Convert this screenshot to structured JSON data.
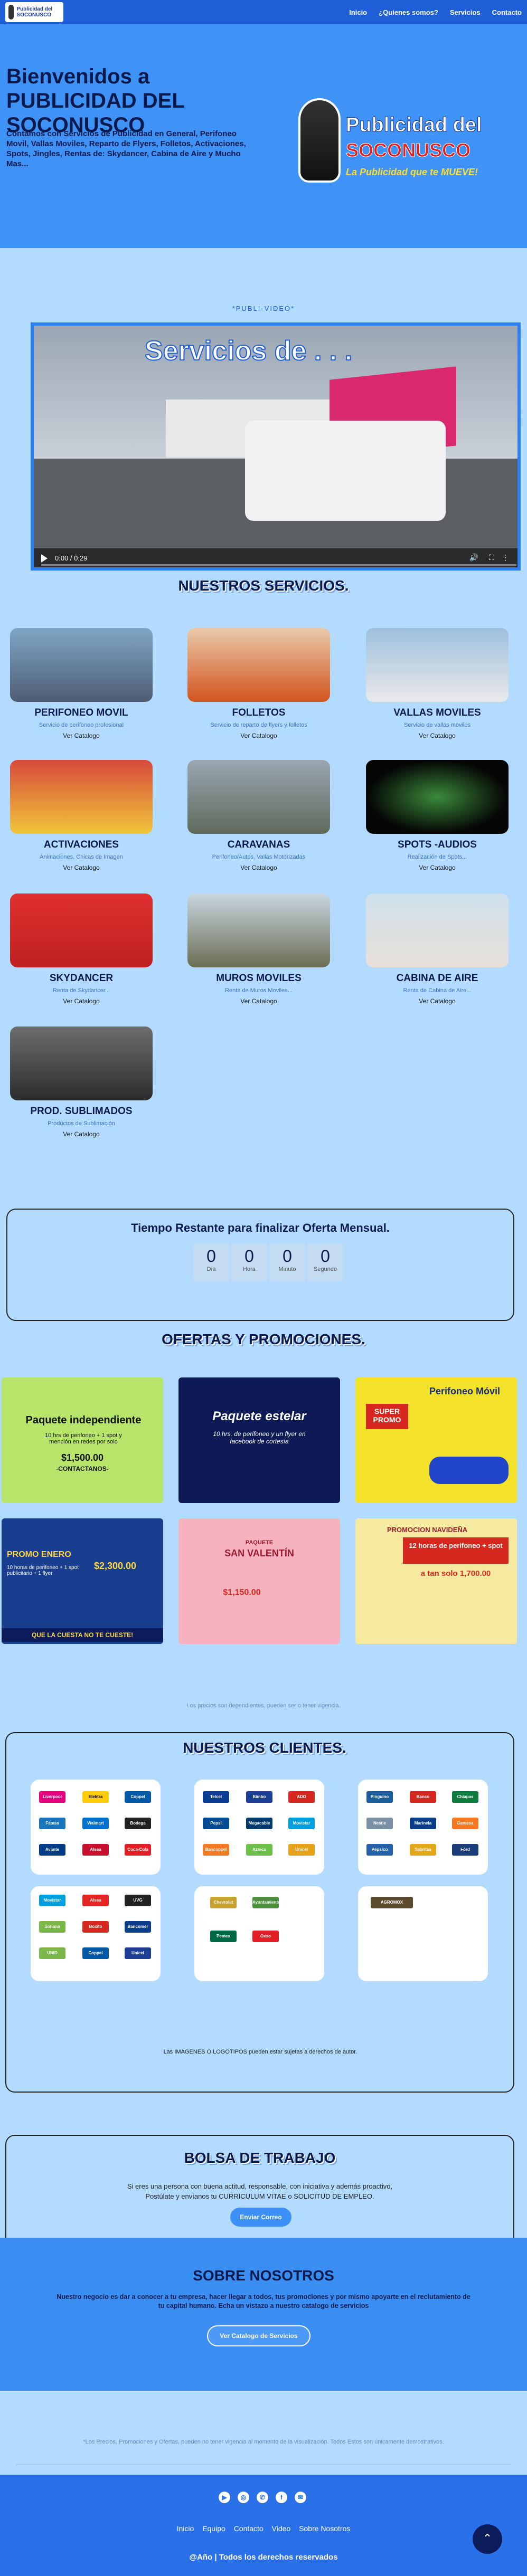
{
  "nav": {
    "logo_text": "Publicidad del SOCONUSCO",
    "links": [
      "Inicio",
      "¿Quienes somos?",
      "Servicios",
      "Contacto"
    ]
  },
  "hero": {
    "title": "Bienvenidos a PUBLICIDAD DEL SOCONUSCO",
    "description": "Contamos con Servicios de Publicidad en General, Perifoneo Movil, Vallas Moviles, Reparto de Flyers, Folletos, Activaciones, Spots, Jingles, Rentas de: Skydancer, Cabina de Aire y Mucho Mas...",
    "logo_line1": "Publicidad del",
    "logo_line2": "SOCONUSCO",
    "logo_line3": "La Publicidad que te MUEVE!"
  },
  "video": {
    "label": "*PUBLI-VIDEO*",
    "overlay_title": "Servicios de . . .",
    "time": "0:00 / 0:29"
  },
  "services_section": {
    "title": "NUESTROS SERVICIOS.",
    "items": [
      {
        "name": "PERIFONEO MOVIL",
        "desc": "Servicio de perifoneo profesional",
        "cta": "Ver Catalogo"
      },
      {
        "name": "FOLLETOS",
        "desc": "Servicio de reparto de flyers y folletos",
        "cta": "Ver Catalogo"
      },
      {
        "name": "VALLAS MOVILES",
        "desc": "Servicio de vallas moviles",
        "cta": "Ver Catalogo"
      },
      {
        "name": "ACTIVACIONES",
        "desc": "Animaciones, Chicas de Imagen",
        "cta": "Ver Catalogo"
      },
      {
        "name": "CARAVANAS",
        "desc": "Perifoneo/Autos, Vallas Motorizadas",
        "cta": "Ver Catalogo"
      },
      {
        "name": "SPOTS -AUDIOS",
        "desc": "Realización de Spots...",
        "cta": "Ver Catalogo"
      },
      {
        "name": "SKYDANCER",
        "desc": "Renta de Skydancer...",
        "cta": "Ver Catalogo"
      },
      {
        "name": "MUROS MOVILES",
        "desc": "Renta de Muros Moviles...",
        "cta": "Ver Catalogo"
      },
      {
        "name": "CABINA DE AIRE",
        "desc": "Renta de Cabina de Aire...",
        "cta": "Ver Catalogo"
      },
      {
        "name": "PROD. SUBLIMADOS",
        "desc": "Productos de Sublimación",
        "cta": "Ver Catalogo"
      }
    ]
  },
  "timer": {
    "title": "Tiempo Restante para finalizar Oferta Mensual.",
    "units": [
      {
        "value": "0",
        "label": "Día"
      },
      {
        "value": "0",
        "label": "Hora"
      },
      {
        "value": "0",
        "label": "Minuto"
      },
      {
        "value": "0",
        "label": "Segundo"
      }
    ]
  },
  "offers_section": {
    "title": "OFERTAS Y PROMOCIONES.",
    "offers": [
      {
        "headline": "Paquete independiente",
        "sub": "10 hrs de perifoneo + 1 spot y mención en redes por solo",
        "price": "$1,500.00",
        "extra": "-CONTACTANOS-",
        "bg": "#b7e56a"
      },
      {
        "headline": "Paquete estelar",
        "sub": "10 hrs. de perifoneo y un flyer en facebook de cortesía",
        "price": "",
        "extra": "",
        "bg": "#0d1a55"
      },
      {
        "headline": "Perifoneo Móvil",
        "sub": "SUPER PROMO",
        "price": "",
        "extra": "",
        "bg": "#f4e22a"
      },
      {
        "headline": "PROMO ENERO",
        "sub": "10 horas de perifoneo + 1 spot publicitario + 1 flyer",
        "price": "$2,300.00",
        "extra": "QUE LA CUESTA NO TE CUESTE!",
        "bg": "#1a3e8f"
      },
      {
        "headline": "SAN VALENTÍN",
        "sub": "PAQUETE",
        "price": "$1,150.00",
        "extra": "",
        "bg": "#f6b3bf"
      },
      {
        "headline": "PROMOCION NAVIDEÑA",
        "sub": "12 horas de perifoneo + spot",
        "price": "a tan solo 1,700.00",
        "extra": "",
        "bg": "#f5eaa0"
      }
    ],
    "note": "Los precios son dependientes, pueden ser o tener vigencia."
  },
  "clients_section": {
    "title": "NUESTROS CLIENTES.",
    "card1": [
      "Liverpool",
      "Elektra",
      "Coppel",
      "Famsa",
      "Walmart",
      "Bodega",
      "Avante",
      "Alsea",
      "Coca-Cola"
    ],
    "card2": [
      "Telcel",
      "Bimbo",
      "ADO",
      "Pepsi",
      "Megacable",
      "Movistar",
      "Bancoppel",
      "Azteca",
      "Unicel"
    ],
    "card3": [
      "Pinguino",
      "Banco",
      "Chiapas",
      "Nestle",
      "Marinela",
      "Gamesa",
      "Pepsico",
      "Sabritas",
      "Ford"
    ],
    "card4": [
      "Movistar",
      "Alsea",
      "Soriana",
      "Boxito",
      "Bancomer",
      "UNID",
      "Coppel",
      "Unicel",
      "UVG"
    ],
    "card5": [
      "Chevrolet",
      "Ayuntamiento",
      "Pemex",
      "Oxxo"
    ],
    "card6": [
      "AGROMOX"
    ],
    "note": "Las IMAGENES O LOGOTIPOS pueden estar sujetas a derechos de autor."
  },
  "bolsa": {
    "title": "BOLSA DE TRABAJO",
    "line1": "Si eres una persona con buena actitud, responsable, con iniciativa y además proactivo,",
    "line2": "Postúlate y envíanos tu CURRICULUM VITAE o SOLICITUD DE EMPLEO.",
    "button": "Enviar Correo"
  },
  "sobre": {
    "title": "SOBRE NOSOTROS",
    "line1": "Nuestro negocio es dar a conocer a tu empresa, hacer llegar a todos, tus promociones y por mismo apoyarte en el reclutamiento de",
    "line2": "tu capital humano. Echa un vistazo a nuestro catalogo de servicios",
    "button": "Ver Catalogo de Servicios"
  },
  "disclaimer": "*Los Precios, Promociones y Ofertas, pueden no tener vigencia al momento de la visualización. Todos Estos son únicamente demostrativos.",
  "footer": {
    "icons": [
      "youtube-icon",
      "instagram-icon",
      "whatsapp-icon",
      "facebook-icon",
      "mail-icon"
    ],
    "links": [
      "Inicio",
      "Equipo",
      "Contacto",
      "Video",
      "Sobre Nosotros"
    ],
    "copyright": "@Año | Todos los derechos reservados",
    "scroll_top": "⌃"
  },
  "colors": {
    "page_bg": "#b3dbff",
    "nav_bg": "#1e5fd7",
    "hero_bg": "#3f92f6",
    "title_dark": "#0b1a4d",
    "accent": "#3d90f7"
  }
}
